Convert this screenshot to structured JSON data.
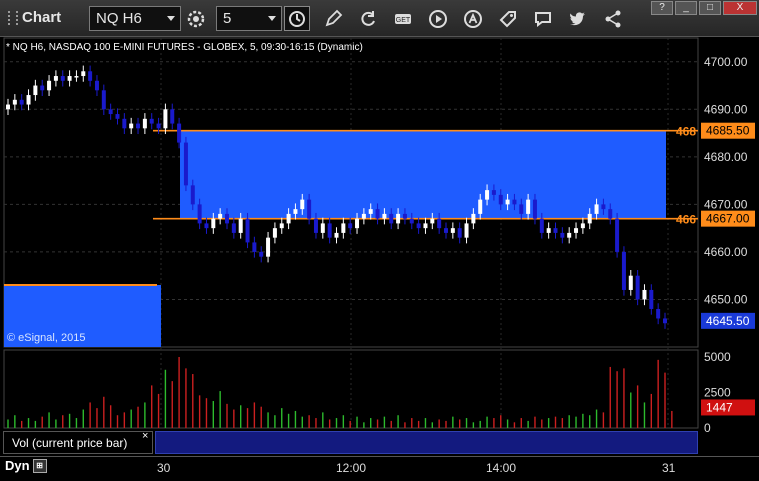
{
  "toolbar": {
    "title": "Chart",
    "symbol": "NQ H6",
    "interval": "5",
    "icons": [
      "gear-icon",
      "clock-icon",
      "pencil-icon",
      "refresh-icon",
      "get-icon",
      "play-icon",
      "alert-icon",
      "tag-icon",
      "comment-icon",
      "twitter-icon",
      "share-icon"
    ],
    "window_controls": [
      "?",
      "_",
      "□",
      "X"
    ]
  },
  "chart": {
    "header": "* NQ H6, NASDAQ 100 E-MINI FUTURES - GLOBEX, 5, 09:30-16:15 (Dynamic)",
    "copyright": "© eSignal, 2015",
    "price_axis": [
      "4700.00",
      "4690.00",
      "4680.00",
      "4670.00",
      "4660.00",
      "4650.00"
    ],
    "tags": {
      "upper": {
        "left": "468",
        "value": "4685.50"
      },
      "lower": {
        "left": "466",
        "value": "4667.00"
      },
      "current": {
        "value": "4645.50"
      }
    },
    "volume_axis": [
      "5000",
      "2500",
      "0"
    ],
    "volume_tag": "1447",
    "volume_label": "Vol (current price bar)",
    "close_glyph": "×",
    "time_labels": [
      "30",
      "12:00",
      "14:00",
      "31"
    ],
    "dyn_label": "Dyn",
    "colors": {
      "zone": "#1f5cff",
      "level": "#ff8c1a",
      "up": "#ffffff",
      "down": "#1a1acc",
      "vol_up": "#2dbb2d",
      "vol_down": "#cc2020"
    }
  },
  "chart_data": {
    "type": "candlestick",
    "ylim": [
      4640,
      4705
    ],
    "zones": [
      [
        4667.0,
        4685.5
      ]
    ],
    "levels": [
      4685.5,
      4667.0
    ],
    "closes": [
      4691,
      4692,
      4691,
      4693,
      4695,
      4694,
      4696,
      4697,
      4696,
      4697,
      4697,
      4698,
      4696,
      4694,
      4690,
      4689,
      4688,
      4686,
      4687,
      4686,
      4688,
      4687,
      4686,
      4690,
      4687,
      4683,
      4674,
      4670,
      4666,
      4665,
      4667,
      4668,
      4666,
      4664,
      4667,
      4662,
      4660,
      4659,
      4663,
      4665,
      4666,
      4668,
      4669,
      4671,
      4667,
      4664,
      4666,
      4663,
      4664,
      4666,
      4665,
      4667,
      4668,
      4669,
      4667,
      4668,
      4666,
      4668,
      4667,
      4666,
      4665,
      4666,
      4667,
      4665,
      4664,
      4665,
      4663,
      4666,
      4668,
      4671,
      4673,
      4672,
      4670,
      4671,
      4670,
      4668,
      4671,
      4667,
      4664,
      4665,
      4664,
      4663,
      4664,
      4665,
      4666,
      4668,
      4670,
      4669,
      4667,
      4660,
      4652,
      4655,
      4650,
      4652,
      4648,
      4646,
      4645
    ],
    "volume": [
      600,
      900,
      500,
      700,
      500,
      800,
      1100,
      600,
      900,
      1000,
      700,
      1300,
      1800,
      1400,
      2200,
      1600,
      900,
      1100,
      1300,
      1500,
      1800,
      3000,
      2400,
      4100,
      3300,
      5000,
      4200,
      3800,
      2300,
      2100,
      1900,
      2600,
      1700,
      1300,
      1600,
      1400,
      1800,
      1500,
      1100,
      900,
      1400,
      1000,
      1200,
      800,
      900,
      700,
      1100,
      600,
      700,
      900,
      500,
      800,
      400,
      700,
      600,
      800,
      500,
      900,
      400,
      700,
      500,
      700,
      400,
      600,
      500,
      800,
      600,
      700,
      400,
      500,
      800,
      700,
      900,
      600,
      400,
      700,
      500,
      800,
      600,
      700,
      800,
      700,
      900,
      800,
      1000,
      900,
      1300,
      1100,
      4300,
      4000,
      4200,
      2500,
      3000,
      1800,
      2400,
      4800,
      3900,
      1200
    ]
  }
}
